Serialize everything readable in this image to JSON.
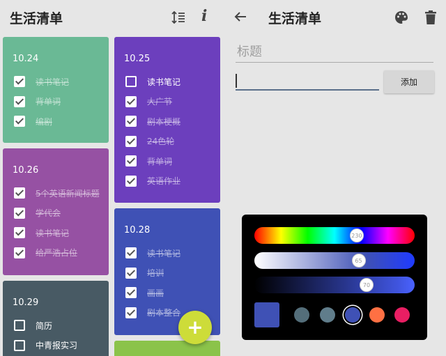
{
  "left": {
    "title": "生活清单",
    "icons": {
      "sort": "sort-icon",
      "info": "info-icon",
      "info_glyph": "i"
    }
  },
  "cards": [
    {
      "date": "10.24",
      "color": "#6ab995",
      "items": [
        {
          "text": "读书笔记",
          "checked": true
        },
        {
          "text": "背单词",
          "checked": true
        },
        {
          "text": "编剧",
          "checked": true
        }
      ]
    },
    {
      "date": "10.26",
      "color": "#9651a3",
      "items": [
        {
          "text": "5个英语新闻标题",
          "checked": true
        },
        {
          "text": "学代会",
          "checked": true
        },
        {
          "text": "读书笔记",
          "checked": true
        },
        {
          "text": "给严浩占位",
          "checked": true
        }
      ]
    },
    {
      "date": "10.29",
      "color": "#485a64",
      "items": [
        {
          "text": "简历",
          "checked": false
        },
        {
          "text": "中青报实习",
          "checked": false
        }
      ]
    },
    {
      "date": "10.25",
      "color": "#6c3fbd",
      "items": [
        {
          "text": "读书笔记",
          "checked": false
        },
        {
          "text": "大广节",
          "checked": true
        },
        {
          "text": "剧本梗概",
          "checked": true
        },
        {
          "text": "24色轮",
          "checked": true
        },
        {
          "text": "背单词",
          "checked": true
        },
        {
          "text": "英语作业",
          "checked": true
        }
      ]
    },
    {
      "date": "10.28",
      "color": "#3f51b5",
      "items": [
        {
          "text": "读书笔记",
          "checked": true
        },
        {
          "text": "培训",
          "checked": true
        },
        {
          "text": "画画",
          "checked": true
        },
        {
          "text": "剧本整合",
          "checked": true
        }
      ]
    },
    {
      "date": "",
      "color": "#8bc34a",
      "items": []
    }
  ],
  "fab": {
    "label": "+",
    "color": "#cddc39"
  },
  "detail": {
    "title": "生活清单",
    "title_placeholder": "标题",
    "item_input_value": "",
    "add_label": "添加",
    "icons": {
      "back": "arrow-left-icon",
      "palette": "palette-icon",
      "delete": "trash-icon"
    }
  },
  "color_picker": {
    "hue": 230,
    "saturation": 65,
    "value": 70,
    "hue_label": "230",
    "saturation_label": "65",
    "value_label": "70",
    "selected_color": "#3f51b5",
    "swatches": [
      "#546e7a",
      "#607d8b",
      "#3f51b5",
      "#ff7043",
      "#e91e63"
    ],
    "selected_swatch": 2
  }
}
